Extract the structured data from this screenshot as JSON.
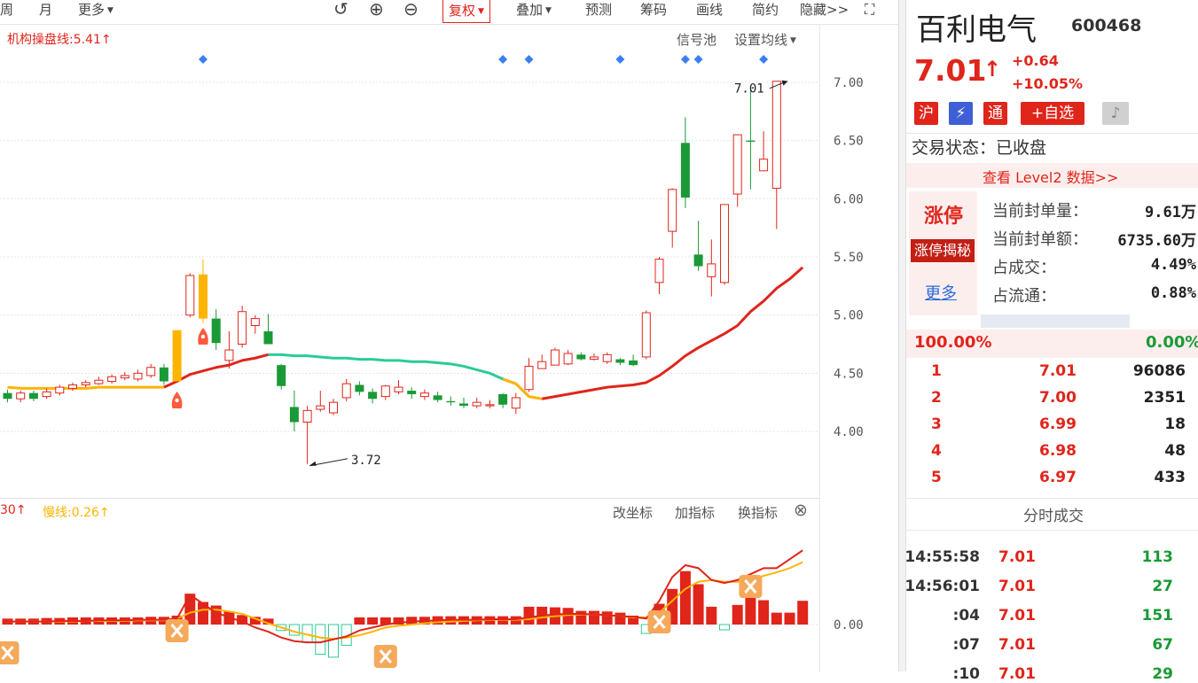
{
  "toolbar": {
    "week": "周",
    "month": "月",
    "more": "更多",
    "restore": "复权",
    "overlay": "叠加",
    "predict": "预测",
    "chips": "筹码",
    "draw": "画线",
    "simple": "简约",
    "hide": "隐藏>>"
  },
  "main_chart": {
    "indicator_label": "机构操盘线:5.41",
    "signal_pool": "信号池",
    "ma_settings": "设置均线",
    "high_label": "7.01",
    "low_label": "3.72"
  },
  "sub_chart": {
    "fast_label": "30",
    "slow_label": "慢线:0.26",
    "change_axis": "改坐标",
    "add_indicator": "加指标",
    "swap_indicator": "换指标"
  },
  "chart_data": {
    "type": "candlestick",
    "ylim": [
      3.6,
      7.1
    ],
    "y_ticks": [
      "7.00",
      "6.50",
      "6.00",
      "5.50",
      "5.00",
      "4.50",
      "4.00"
    ],
    "sub_y_tick": "0.00",
    "candles": [
      {
        "o": 4.33,
        "c": 4.28,
        "h": 4.36,
        "l": 4.25
      },
      {
        "o": 4.28,
        "c": 4.33,
        "h": 4.35,
        "l": 4.25
      },
      {
        "o": 4.33,
        "c": 4.28,
        "h": 4.35,
        "l": 4.26
      },
      {
        "o": 4.3,
        "c": 4.34,
        "h": 4.37,
        "l": 4.28
      },
      {
        "o": 4.33,
        "c": 4.38,
        "h": 4.4,
        "l": 4.31
      },
      {
        "o": 4.37,
        "c": 4.4,
        "h": 4.42,
        "l": 4.35
      },
      {
        "o": 4.4,
        "c": 4.42,
        "h": 4.44,
        "l": 4.38
      },
      {
        "o": 4.41,
        "c": 4.44,
        "h": 4.47,
        "l": 4.4
      },
      {
        "o": 4.43,
        "c": 4.47,
        "h": 4.49,
        "l": 4.41
      },
      {
        "o": 4.46,
        "c": 4.48,
        "h": 4.51,
        "l": 4.44
      },
      {
        "o": 4.45,
        "c": 4.5,
        "h": 4.53,
        "l": 4.43
      },
      {
        "o": 4.48,
        "c": 4.55,
        "h": 4.58,
        "l": 4.46
      },
      {
        "o": 4.55,
        "c": 4.43,
        "h": 4.58,
        "l": 4.4
      },
      {
        "o": 4.43,
        "c": 4.87,
        "h": 4.87,
        "l": 4.43
      },
      {
        "o": 5.0,
        "c": 5.34,
        "h": 5.36,
        "l": 4.98
      },
      {
        "o": 5.35,
        "c": 4.97,
        "h": 5.48,
        "l": 4.93
      },
      {
        "o": 4.97,
        "c": 4.76,
        "h": 5.05,
        "l": 4.7
      },
      {
        "o": 4.61,
        "c": 4.7,
        "h": 4.86,
        "l": 4.54
      },
      {
        "o": 4.75,
        "c": 5.03,
        "h": 5.08,
        "l": 4.72
      },
      {
        "o": 4.91,
        "c": 4.97,
        "h": 5.0,
        "l": 4.84
      },
      {
        "o": 4.86,
        "c": 4.75,
        "h": 5.01,
        "l": 4.75
      },
      {
        "o": 4.57,
        "c": 4.39,
        "h": 4.58,
        "l": 4.36
      },
      {
        "o": 4.21,
        "c": 4.08,
        "h": 4.35,
        "l": 4.0
      },
      {
        "o": 4.08,
        "c": 4.18,
        "h": 4.22,
        "l": 3.72
      },
      {
        "o": 4.19,
        "c": 4.22,
        "h": 4.35,
        "l": 4.17
      },
      {
        "o": 4.16,
        "c": 4.25,
        "h": 4.28,
        "l": 4.14
      },
      {
        "o": 4.29,
        "c": 4.41,
        "h": 4.45,
        "l": 4.26
      },
      {
        "o": 4.4,
        "c": 4.34,
        "h": 4.43,
        "l": 4.31
      },
      {
        "o": 4.34,
        "c": 4.28,
        "h": 4.37,
        "l": 4.24
      },
      {
        "o": 4.3,
        "c": 4.39,
        "h": 4.4,
        "l": 4.27
      },
      {
        "o": 4.34,
        "c": 4.38,
        "h": 4.44,
        "l": 4.32
      },
      {
        "o": 4.35,
        "c": 4.32,
        "h": 4.38,
        "l": 4.28
      },
      {
        "o": 4.3,
        "c": 4.33,
        "h": 4.36,
        "l": 4.27
      },
      {
        "o": 4.31,
        "c": 4.27,
        "h": 4.34,
        "l": 4.25
      },
      {
        "o": 4.26,
        "c": 4.25,
        "h": 4.3,
        "l": 4.22
      },
      {
        "o": 4.24,
        "c": 4.22,
        "h": 4.29,
        "l": 4.2
      },
      {
        "o": 4.22,
        "c": 4.25,
        "h": 4.29,
        "l": 4.2
      },
      {
        "o": 4.22,
        "c": 4.23,
        "h": 4.27,
        "l": 4.2
      },
      {
        "o": 4.32,
        "c": 4.23,
        "h": 4.33,
        "l": 4.2
      },
      {
        "o": 4.2,
        "c": 4.29,
        "h": 4.33,
        "l": 4.15
      },
      {
        "o": 4.36,
        "c": 4.56,
        "h": 4.63,
        "l": 4.34
      },
      {
        "o": 4.54,
        "c": 4.6,
        "h": 4.66,
        "l": 4.54
      },
      {
        "o": 4.57,
        "c": 4.7,
        "h": 4.72,
        "l": 4.57
      },
      {
        "o": 4.58,
        "c": 4.67,
        "h": 4.7,
        "l": 4.57
      },
      {
        "o": 4.66,
        "c": 4.62,
        "h": 4.68,
        "l": 4.61
      },
      {
        "o": 4.62,
        "c": 4.64,
        "h": 4.67,
        "l": 4.61
      },
      {
        "o": 4.6,
        "c": 4.66,
        "h": 4.68,
        "l": 4.58
      },
      {
        "o": 4.62,
        "c": 4.59,
        "h": 4.63,
        "l": 4.57
      },
      {
        "o": 4.61,
        "c": 4.57,
        "h": 4.66,
        "l": 4.56
      },
      {
        "o": 4.64,
        "c": 5.02,
        "h": 5.04,
        "l": 4.62
      },
      {
        "o": 5.28,
        "c": 5.48,
        "h": 5.5,
        "l": 5.18
      },
      {
        "o": 5.72,
        "c": 6.08,
        "h": 6.09,
        "l": 5.58
      },
      {
        "o": 6.48,
        "c": 6.01,
        "h": 6.7,
        "l": 5.92
      },
      {
        "o": 5.52,
        "c": 5.42,
        "h": 5.81,
        "l": 5.38
      },
      {
        "o": 5.33,
        "c": 5.44,
        "h": 5.65,
        "l": 5.16
      },
      {
        "o": 5.28,
        "c": 5.95,
        "h": 5.95,
        "l": 5.26
      },
      {
        "o": 6.04,
        "c": 6.55,
        "h": 6.55,
        "l": 5.93
      },
      {
        "o": 6.5,
        "c": 6.49,
        "h": 6.97,
        "l": 6.08
      },
      {
        "o": 6.24,
        "c": 6.34,
        "h": 6.58,
        "l": 6.24
      },
      {
        "o": 6.09,
        "c": 7.01,
        "h": 7.01,
        "l": 5.74
      }
    ],
    "institution_line": [
      4.38,
      4.37,
      4.37,
      4.37,
      4.37,
      4.37,
      4.37,
      4.38,
      4.38,
      4.38,
      4.38,
      4.38,
      4.38,
      4.43,
      4.49,
      4.52,
      4.55,
      4.57,
      4.61,
      4.63,
      4.66,
      4.66,
      4.65,
      4.65,
      4.64,
      4.63,
      4.63,
      4.62,
      4.62,
      4.61,
      4.61,
      4.6,
      4.6,
      4.59,
      4.58,
      4.56,
      4.53,
      4.5,
      4.45,
      4.41,
      4.3,
      4.28,
      4.3,
      4.32,
      4.34,
      4.36,
      4.38,
      4.39,
      4.4,
      4.42,
      4.48,
      4.56,
      4.65,
      4.72,
      4.78,
      4.84,
      4.91,
      5.03,
      5.12,
      5.23,
      5.31,
      5.41
    ],
    "institution_line_colors": "yellow:0-12,red:12-20,green:20-40,yellow:38-41,red:41-61",
    "macd_hist": [
      0.1,
      0.1,
      0.1,
      0.11,
      0.11,
      0.12,
      0.12,
      0.12,
      0.12,
      0.12,
      0.12,
      0.13,
      0.13,
      0.15,
      0.52,
      0.38,
      0.32,
      0.22,
      0.16,
      0.13,
      0.1,
      -0.1,
      -0.18,
      -0.3,
      -0.5,
      -0.55,
      -0.35,
      0.12,
      0.12,
      0.12,
      0.12,
      0.13,
      0.13,
      0.14,
      0.14,
      0.14,
      0.14,
      0.14,
      0.14,
      0.14,
      0.3,
      0.3,
      0.29,
      0.28,
      0.23,
      0.23,
      0.22,
      0.2,
      0.15,
      -0.15,
      0.35,
      0.6,
      0.9,
      0.68,
      0.3,
      -0.09,
      0.33,
      0.7,
      0.41,
      0.2,
      0.2,
      0.4
    ],
    "macd_fast": [
      0.05,
      0.05,
      0.05,
      0.05,
      0.06,
      0.06,
      0.06,
      0.07,
      0.07,
      0.07,
      0.08,
      0.08,
      0.08,
      0.1,
      0.5,
      0.35,
      0.2,
      0.12,
      0.05,
      -0.05,
      -0.12,
      -0.22,
      -0.28,
      -0.3,
      -0.3,
      -0.25,
      -0.2,
      -0.1,
      -0.05,
      0.0,
      0.03,
      0.05,
      0.06,
      0.07,
      0.08,
      0.08,
      0.08,
      0.09,
      0.09,
      0.09,
      0.12,
      0.15,
      0.17,
      0.18,
      0.18,
      0.17,
      0.16,
      0.14,
      0.13,
      0.1,
      0.4,
      0.8,
      1.0,
      0.95,
      0.75,
      0.7,
      0.75,
      0.85,
      0.95,
      0.95,
      1.1,
      1.25
    ],
    "macd_slow": [
      0.05,
      0.05,
      0.05,
      0.05,
      0.05,
      0.05,
      0.06,
      0.06,
      0.06,
      0.06,
      0.07,
      0.07,
      0.07,
      0.1,
      0.2,
      0.25,
      0.25,
      0.22,
      0.18,
      0.1,
      0.02,
      -0.05,
      -0.12,
      -0.17,
      -0.22,
      -0.24,
      -0.22,
      -0.18,
      -0.12,
      -0.05,
      -0.02,
      0.0,
      0.02,
      0.04,
      0.05,
      0.06,
      0.07,
      0.08,
      0.08,
      0.08,
      0.09,
      0.12,
      0.14,
      0.16,
      0.17,
      0.17,
      0.16,
      0.14,
      0.12,
      0.12,
      0.2,
      0.4,
      0.6,
      0.72,
      0.75,
      0.72,
      0.72,
      0.76,
      0.82,
      0.88,
      0.95,
      1.05
    ]
  },
  "stock": {
    "name": "百利电气",
    "code": "600468",
    "price": "7.01",
    "change": "+0.64",
    "change_pct": "+10.05%",
    "tag_sh": "沪",
    "tag_flash": "",
    "tag_tong": "通",
    "add_watch": "+自选",
    "status": "交易状态：已收盘",
    "level2": "查看 Level2 数据>>"
  },
  "limit": {
    "title": "涨停",
    "reveal": "涨停揭秘",
    "more": "更多",
    "rows": [
      {
        "label": "当前封单量：",
        "value": "9.61万"
      },
      {
        "label": "当前封单额：",
        "value": "6735.60万"
      },
      {
        "label": "占成交：",
        "value": "4.49%"
      },
      {
        "label": "占流通：",
        "value": "0.88%"
      }
    ]
  },
  "orderbook": {
    "buy_pct": "100.00%",
    "sell_pct": "0.00%",
    "rows": [
      {
        "lvl": "1",
        "price": "7.01",
        "vol": "96086"
      },
      {
        "lvl": "2",
        "price": "7.00",
        "vol": "2351"
      },
      {
        "lvl": "3",
        "price": "6.99",
        "vol": "18"
      },
      {
        "lvl": "4",
        "price": "6.98",
        "vol": "48"
      },
      {
        "lvl": "5",
        "price": "6.97",
        "vol": "433"
      }
    ]
  },
  "ticks": {
    "title": "分时成交",
    "rows": [
      {
        "time": "14:55:58",
        "price": "7.01",
        "vol": "113"
      },
      {
        "time": "14:56:01",
        "price": "7.01",
        "vol": "27"
      },
      {
        "time": ":04",
        "price": "7.01",
        "vol": "151"
      },
      {
        "time": ":07",
        "price": "7.01",
        "vol": "67"
      },
      {
        "time": ":10",
        "price": "7.01",
        "vol": "29"
      }
    ]
  },
  "colors": {
    "up": "#e0251b",
    "down": "#1a9a36",
    "yellow": "#ffb400",
    "teal": "#2ccb99",
    "marker": "#3b7ff5"
  }
}
